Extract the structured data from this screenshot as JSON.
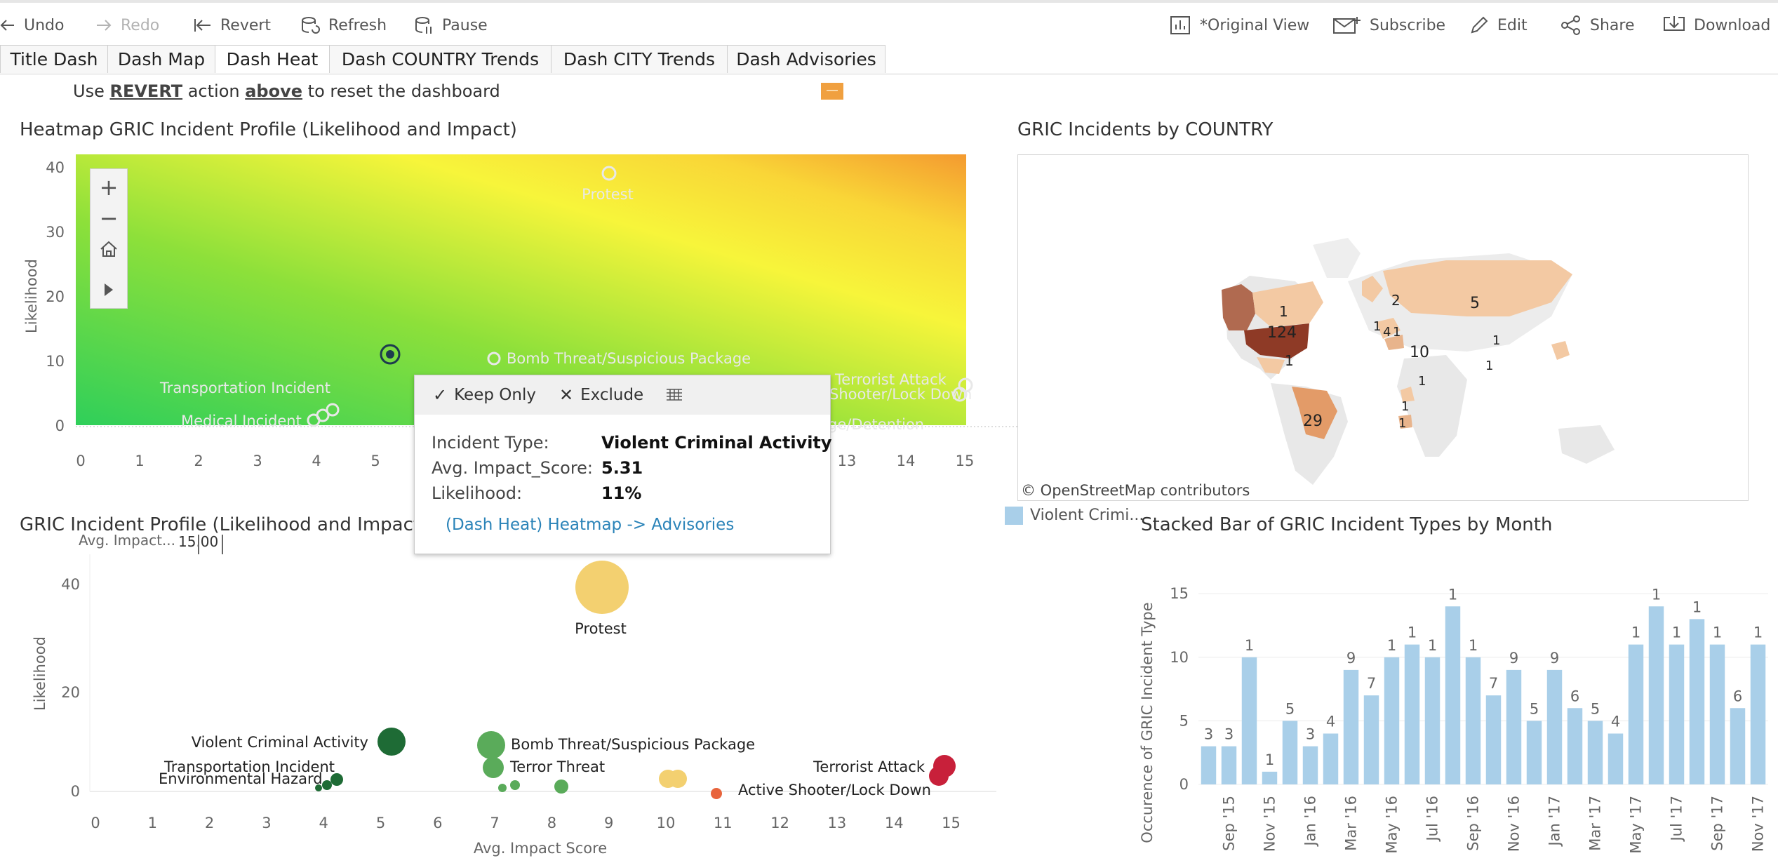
{
  "toolbar": {
    "undo": "Undo",
    "redo": "Redo",
    "revert": "Revert",
    "refresh": "Refresh",
    "pause": "Pause",
    "original_view": "*Original View",
    "subscribe": "Subscribe",
    "edit": "Edit",
    "share": "Share",
    "download": "Download"
  },
  "tabs": [
    "Title Dash",
    "Dash Map",
    "Dash Heat",
    "Dash COUNTRY Trends",
    "Dash CITY Trends",
    "Dash Advisories"
  ],
  "active_tab": "Dash Heat",
  "note": {
    "pre": "Use ",
    "revert": "REVERT",
    "mid": " action ",
    "above": "above",
    "post": " to reset the dashboard"
  },
  "heatmap": {
    "title": "Heatmap GRIC Incident Profile (Likelihood and Impact)",
    "ylabel": "Likelihood",
    "xticks": [
      "0",
      "1",
      "2",
      "3",
      "4",
      "5",
      "6",
      "7",
      "8",
      "9",
      "10",
      "11",
      "12",
      "13",
      "14",
      "15"
    ],
    "yticks": [
      "0",
      "10",
      "20",
      "30",
      "40"
    ],
    "labels": {
      "protest": "Protest",
      "bomb": "Bomb Threat/Suspicious Package",
      "transport": "Transportation Incident",
      "medical": "Medical Incident",
      "terrorist": "Terrorist Attack",
      "lockdown": "Shooter/Lock Down",
      "detention": "ge/Detention"
    }
  },
  "map": {
    "title": "GRIC Incidents by COUNTRY",
    "attribution": "© OpenStreetMap contributors",
    "legend": "Violent Crimi...",
    "counts": {
      "usa": "124",
      "brazil": "29",
      "russia": "5",
      "uk": "2",
      "europe": "10",
      "mexico": "1",
      "canada": "1",
      "a": "1",
      "b": "4",
      "c": "1",
      "d": "1",
      "e": "1",
      "f": "1",
      "g": "1",
      "h": "1"
    }
  },
  "tooltip": {
    "keep_only": "Keep Only",
    "exclude": "Exclude",
    "rows": [
      {
        "label": "Incident Type:",
        "value": "Violent Criminal Activity"
      },
      {
        "label": "Avg. Impact_Score:",
        "value": "5.31"
      },
      {
        "label": "Likelihood:",
        "value": "11%"
      }
    ],
    "link": "(Dash Heat) Heatmap -> Advisories"
  },
  "profile": {
    "title": "GRIC Incident Profile (Likelihood and Impact Sc",
    "filter_label": "Avg. Impact...",
    "filter_value": "15.00",
    "ylabel": "Likelihood",
    "xlabel": "Avg. Impact Score",
    "xticks": [
      "0",
      "1",
      "2",
      "3",
      "4",
      "5",
      "6",
      "7",
      "8",
      "9",
      "10",
      "11",
      "12",
      "13",
      "14",
      "15"
    ],
    "yticks": [
      "0",
      "20",
      "40"
    ],
    "labels": {
      "protest": "Protest",
      "violent": "Violent Criminal Activity",
      "transport": "Transportation Incident",
      "environmental": "Environmental Hazard",
      "bomb": "Bomb Threat/Suspicious Package",
      "terror": "Terror Threat",
      "terrorist": "Terrorist Attack",
      "lockdown": "Active Shooter/Lock Down"
    },
    "colors": {
      "protest": "#f3d070",
      "green_dark": "#1e6b35",
      "green_mid": "#5aab5a",
      "orange": "#e8643c",
      "red": "#c8203a"
    }
  },
  "chart_data": {
    "type": "bar",
    "title": "Stacked Bar of GRIC Incident Types by Month",
    "ylabel": "Occurence of GRIC Incident Type",
    "xlabel": "",
    "ylim": [
      0,
      16
    ],
    "yticks": [
      0,
      5,
      10,
      15
    ],
    "categories": [
      "Aug '15",
      "Sep '15",
      "Oct '15",
      "Nov '15",
      "Dec '15",
      "Jan '16",
      "Feb '16",
      "Mar '16",
      "Apr '16",
      "May '16",
      "Jun '16",
      "Jul '16",
      "Aug '16",
      "Sep '16",
      "Oct '16",
      "Nov '16",
      "Dec '16",
      "Jan '17",
      "Feb '17",
      "Mar '17",
      "Apr '17",
      "May '17",
      "Jun '17",
      "Jul '17",
      "Aug '17",
      "Sep '17",
      "Oct '17",
      "Nov '17"
    ],
    "tick_labels": [
      "Sep '15",
      "Nov '15",
      "Jan '16",
      "Mar '16",
      "May '16",
      "Jul '16",
      "Sep '16",
      "Nov '16",
      "Jan '17",
      "Mar '17",
      "May '17",
      "Jul '17",
      "Sep '17",
      "Nov '17"
    ],
    "values": [
      3,
      3,
      10,
      1,
      5,
      3,
      4,
      9,
      7,
      10,
      11,
      10,
      14,
      10,
      7,
      9,
      5,
      9,
      6,
      5,
      4,
      11,
      14,
      11,
      13,
      11,
      6,
      11
    ],
    "data_labels": [
      "3",
      "3",
      "1",
      "1",
      "5",
      "3",
      "4",
      "9",
      "7",
      "1",
      "1",
      "1",
      "1",
      "1",
      "7",
      "9",
      "5",
      "9",
      "6",
      "5",
      "4",
      "1",
      "1",
      "1",
      "1",
      "1",
      "6",
      "1"
    ],
    "color": "#a9cfe9",
    "grid": true
  }
}
